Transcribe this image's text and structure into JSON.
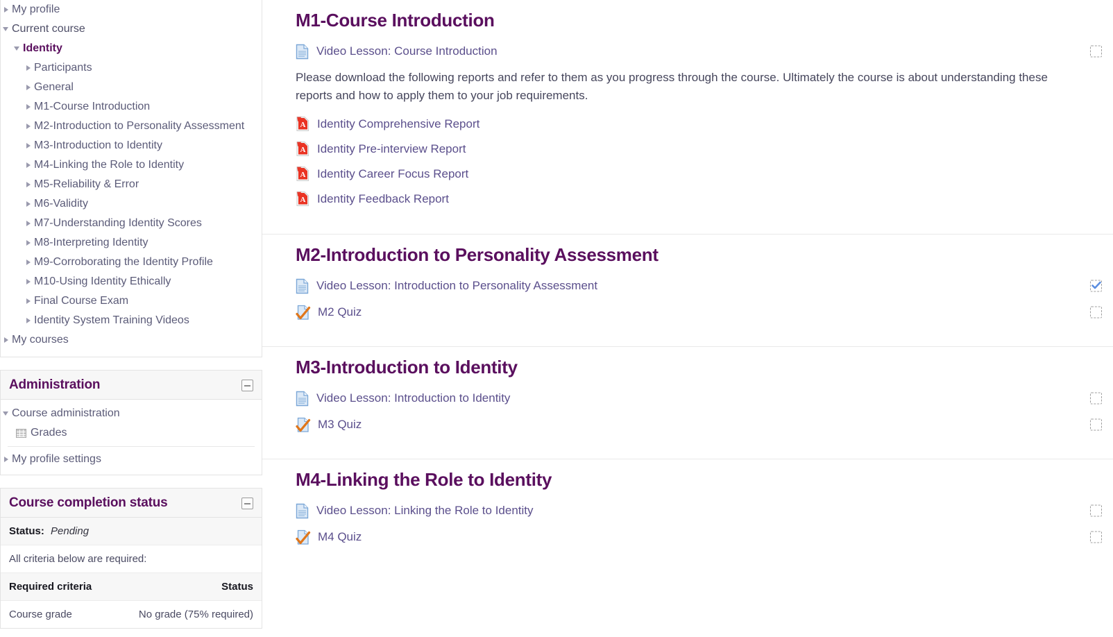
{
  "colors": {
    "heading_purple": "#5a0f5e",
    "link_purple": "#5b4f8c",
    "nav_text": "#5b5b78",
    "body_text": "#46465c",
    "checkbox_tick": "#5c8ee0",
    "pdf_red": "#e02020",
    "quiz_orange": "#e87722"
  },
  "sidebar": {
    "navigation": {
      "items": [
        {
          "label": "My profile",
          "indent": 0,
          "twisty": "closed",
          "style": "link"
        },
        {
          "label": "Current course",
          "indent": 0,
          "twisty": "open",
          "style": "plain"
        },
        {
          "label": "Identity",
          "indent": 1,
          "twisty": "open",
          "style": "current"
        },
        {
          "label": "Participants",
          "indent": 2,
          "twisty": "closed",
          "style": "link"
        },
        {
          "label": "General",
          "indent": 2,
          "twisty": "closed",
          "style": "link"
        },
        {
          "label": "M1-Course Introduction",
          "indent": 2,
          "twisty": "closed",
          "style": "link"
        },
        {
          "label": "M2-Introduction to Personality Assessment",
          "indent": 2,
          "twisty": "closed",
          "style": "link"
        },
        {
          "label": "M3-Introduction to Identity",
          "indent": 2,
          "twisty": "closed",
          "style": "link"
        },
        {
          "label": "M4-Linking the Role to Identity",
          "indent": 2,
          "twisty": "closed",
          "style": "link"
        },
        {
          "label": "M5-Reliability & Error",
          "indent": 2,
          "twisty": "closed",
          "style": "link"
        },
        {
          "label": "M6-Validity",
          "indent": 2,
          "twisty": "closed",
          "style": "link"
        },
        {
          "label": "M7-Understanding Identity Scores",
          "indent": 2,
          "twisty": "closed",
          "style": "link"
        },
        {
          "label": "M8-Interpreting Identity",
          "indent": 2,
          "twisty": "closed",
          "style": "link"
        },
        {
          "label": "M9-Corroborating the Identity Profile",
          "indent": 2,
          "twisty": "closed",
          "style": "link"
        },
        {
          "label": "M10-Using Identity Ethically",
          "indent": 2,
          "twisty": "closed",
          "style": "link"
        },
        {
          "label": "Final Course Exam",
          "indent": 2,
          "twisty": "closed",
          "style": "link"
        },
        {
          "label": "Identity System Training Videos",
          "indent": 2,
          "twisty": "closed",
          "style": "link"
        },
        {
          "label": "My courses",
          "indent": 0,
          "twisty": "closed",
          "style": "link"
        }
      ]
    },
    "administration": {
      "title": "Administration",
      "collapse_icon": "minus-icon",
      "course_administration_label": "Course administration",
      "grades_label": "Grades",
      "grades_icon": "grid-icon",
      "my_profile_settings_label": "My profile settings"
    },
    "completion": {
      "title": "Course completion status",
      "collapse_icon": "minus-icon",
      "status_label": "Status:",
      "status_value": "Pending",
      "criteria_note": "All criteria below are required:",
      "table_headers": [
        "Required criteria",
        "Status"
      ],
      "rows": [
        {
          "criteria": "Course grade",
          "status": "No grade (75% required)"
        }
      ]
    }
  },
  "main": {
    "sections": [
      {
        "title": "M1-Course Introduction",
        "activities": [
          {
            "label": "Video Lesson: Course Introduction",
            "icon": "document-icon",
            "completion": "unchecked"
          }
        ],
        "summary": "Please download the following reports and refer to them as you progress through the course. Ultimately the course is about understanding these reports and how to apply them to your job requirements.",
        "resources": [
          {
            "label": "Identity Comprehensive Report",
            "icon": "pdf-icon"
          },
          {
            "label": "Identity Pre-interview Report",
            "icon": "pdf-icon"
          },
          {
            "label": "Identity Career Focus Report",
            "icon": "pdf-icon"
          },
          {
            "label": "Identity Feedback Report",
            "icon": "pdf-icon"
          }
        ]
      },
      {
        "title": "M2-Introduction to Personality Assessment",
        "activities": [
          {
            "label": "Video Lesson: Introduction to Personality Assessment",
            "icon": "document-icon",
            "completion": "checked"
          },
          {
            "label": "M2 Quiz",
            "icon": "quiz-icon",
            "completion": "unchecked"
          }
        ],
        "summary": "",
        "resources": []
      },
      {
        "title": "M3-Introduction to Identity",
        "activities": [
          {
            "label": "Video Lesson: Introduction to Identity",
            "icon": "document-icon",
            "completion": "unchecked"
          },
          {
            "label": "M3 Quiz",
            "icon": "quiz-icon",
            "completion": "unchecked"
          }
        ],
        "summary": "",
        "resources": []
      },
      {
        "title": "M4-Linking the Role to Identity",
        "activities": [
          {
            "label": "Video Lesson: Linking the Role to Identity",
            "icon": "document-icon",
            "completion": "unchecked"
          },
          {
            "label": "M4 Quiz",
            "icon": "quiz-icon",
            "completion": "unchecked"
          }
        ],
        "summary": "",
        "resources": []
      }
    ]
  }
}
